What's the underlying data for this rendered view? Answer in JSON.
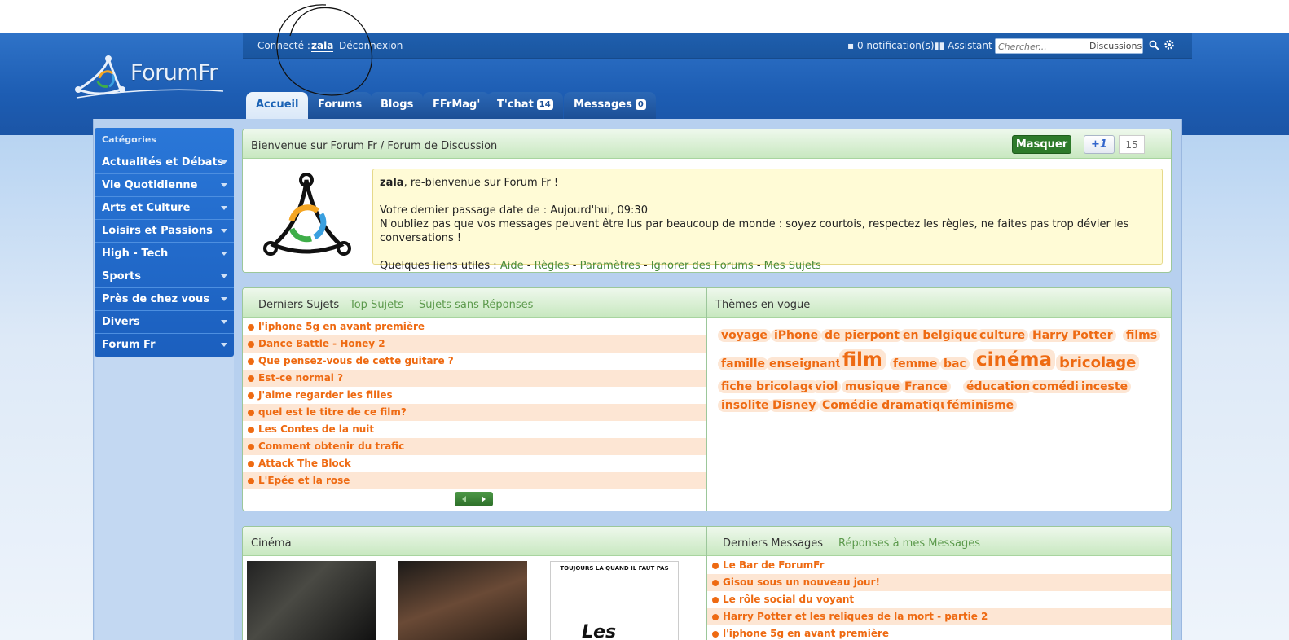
{
  "top": {
    "connected_label": "Connecté :",
    "username": "zala",
    "logout": "Déconnexion",
    "notifications": "0 notification(s)",
    "assistant": "Assistant",
    "search_placeholder": "Chercher...",
    "search_scope": "Discussions"
  },
  "logo": {
    "name": "ForumFr"
  },
  "tabs": [
    {
      "label": "Accueil"
    },
    {
      "label": "Forums"
    },
    {
      "label": "Blogs"
    },
    {
      "label": "FFrMag'"
    },
    {
      "label": "T'chat",
      "badge": "14"
    },
    {
      "label": "Messages",
      "badge": "0"
    }
  ],
  "sidebar": {
    "title": "Catégories",
    "items": [
      {
        "label": "Actualités et Débats"
      },
      {
        "label": "Vie Quotidienne"
      },
      {
        "label": "Arts et Culture"
      },
      {
        "label": "Loisirs et Passions"
      },
      {
        "label": "High - Tech"
      },
      {
        "label": "Sports"
      },
      {
        "label": "Près de chez vous"
      },
      {
        "label": "Divers"
      },
      {
        "label": "Forum Fr"
      }
    ]
  },
  "welcome": {
    "title": "Bienvenue sur Forum Fr / Forum de Discussion",
    "hide_button": "Masquer",
    "plus_one": "+1",
    "plus_one_count": "15",
    "user": "zala",
    "greeting": ", re-bienvenue sur Forum Fr !",
    "last_visit": "Votre dernier passage date de : Aujourd'hui, 09:30",
    "reminder": "N'oubliez pas que vos messages peuvent être lus par beaucoup de monde : soyez courtois, respectez les règles, ne faites pas trop dévier les conversations !",
    "links_label": "Quelques liens utiles : ",
    "links": [
      "Aide",
      "Règles",
      "Paramètres",
      "Ignorer des Forums",
      "Mes Sujets"
    ],
    "separator": " - "
  },
  "subjects": {
    "tabs": [
      "Derniers Sujets",
      "Top Sujets",
      "Sujets sans Réponses"
    ],
    "items": [
      "l'iphone 5g en avant première",
      "Dance Battle - Honey 2",
      "Que pensez-vous de cette guitare ?",
      "Est-ce normal ?",
      "J'aime regarder les filles",
      "quel est le titre de ce film?",
      "Les Contes de la nuit",
      "Comment obtenir du trafic",
      "Attack The Block",
      "L'Epée et la rose"
    ]
  },
  "themes": {
    "title": "Thèmes en vogue",
    "tags": [
      "voyage",
      "iPhone",
      "de pierpont",
      "en belgique",
      "culture",
      "Harry Potter",
      "films",
      "famille",
      "enseignant",
      "film",
      "femme",
      "bac",
      "cinéma",
      "bricolage",
      "fiche bricolage",
      "viol",
      "musique",
      "France",
      "éducation",
      "comédie",
      "inceste",
      "insolite",
      "Disney",
      "Comédie dramatique",
      "féminisme"
    ]
  },
  "cinema": {
    "title": "Cinéma",
    "poster3_tagline": "TOUJOURS LA QUAND IL FAUT PAS",
    "poster3_title": "Les"
  },
  "messages": {
    "tabs": [
      "Derniers Messages",
      "Réponses à mes Messages"
    ],
    "items": [
      "Le Bar de ForumFr",
      "Gisou sous un nouveau jour!",
      "Le rôle social du voyant",
      "Harry Potter et les reliques de la mort - partie 2",
      "l'iphone 5g en avant première"
    ]
  },
  "colors": {
    "accent": "#ee6a12",
    "header_blue": "#1d5db3",
    "green": "#2d7a2a"
  }
}
